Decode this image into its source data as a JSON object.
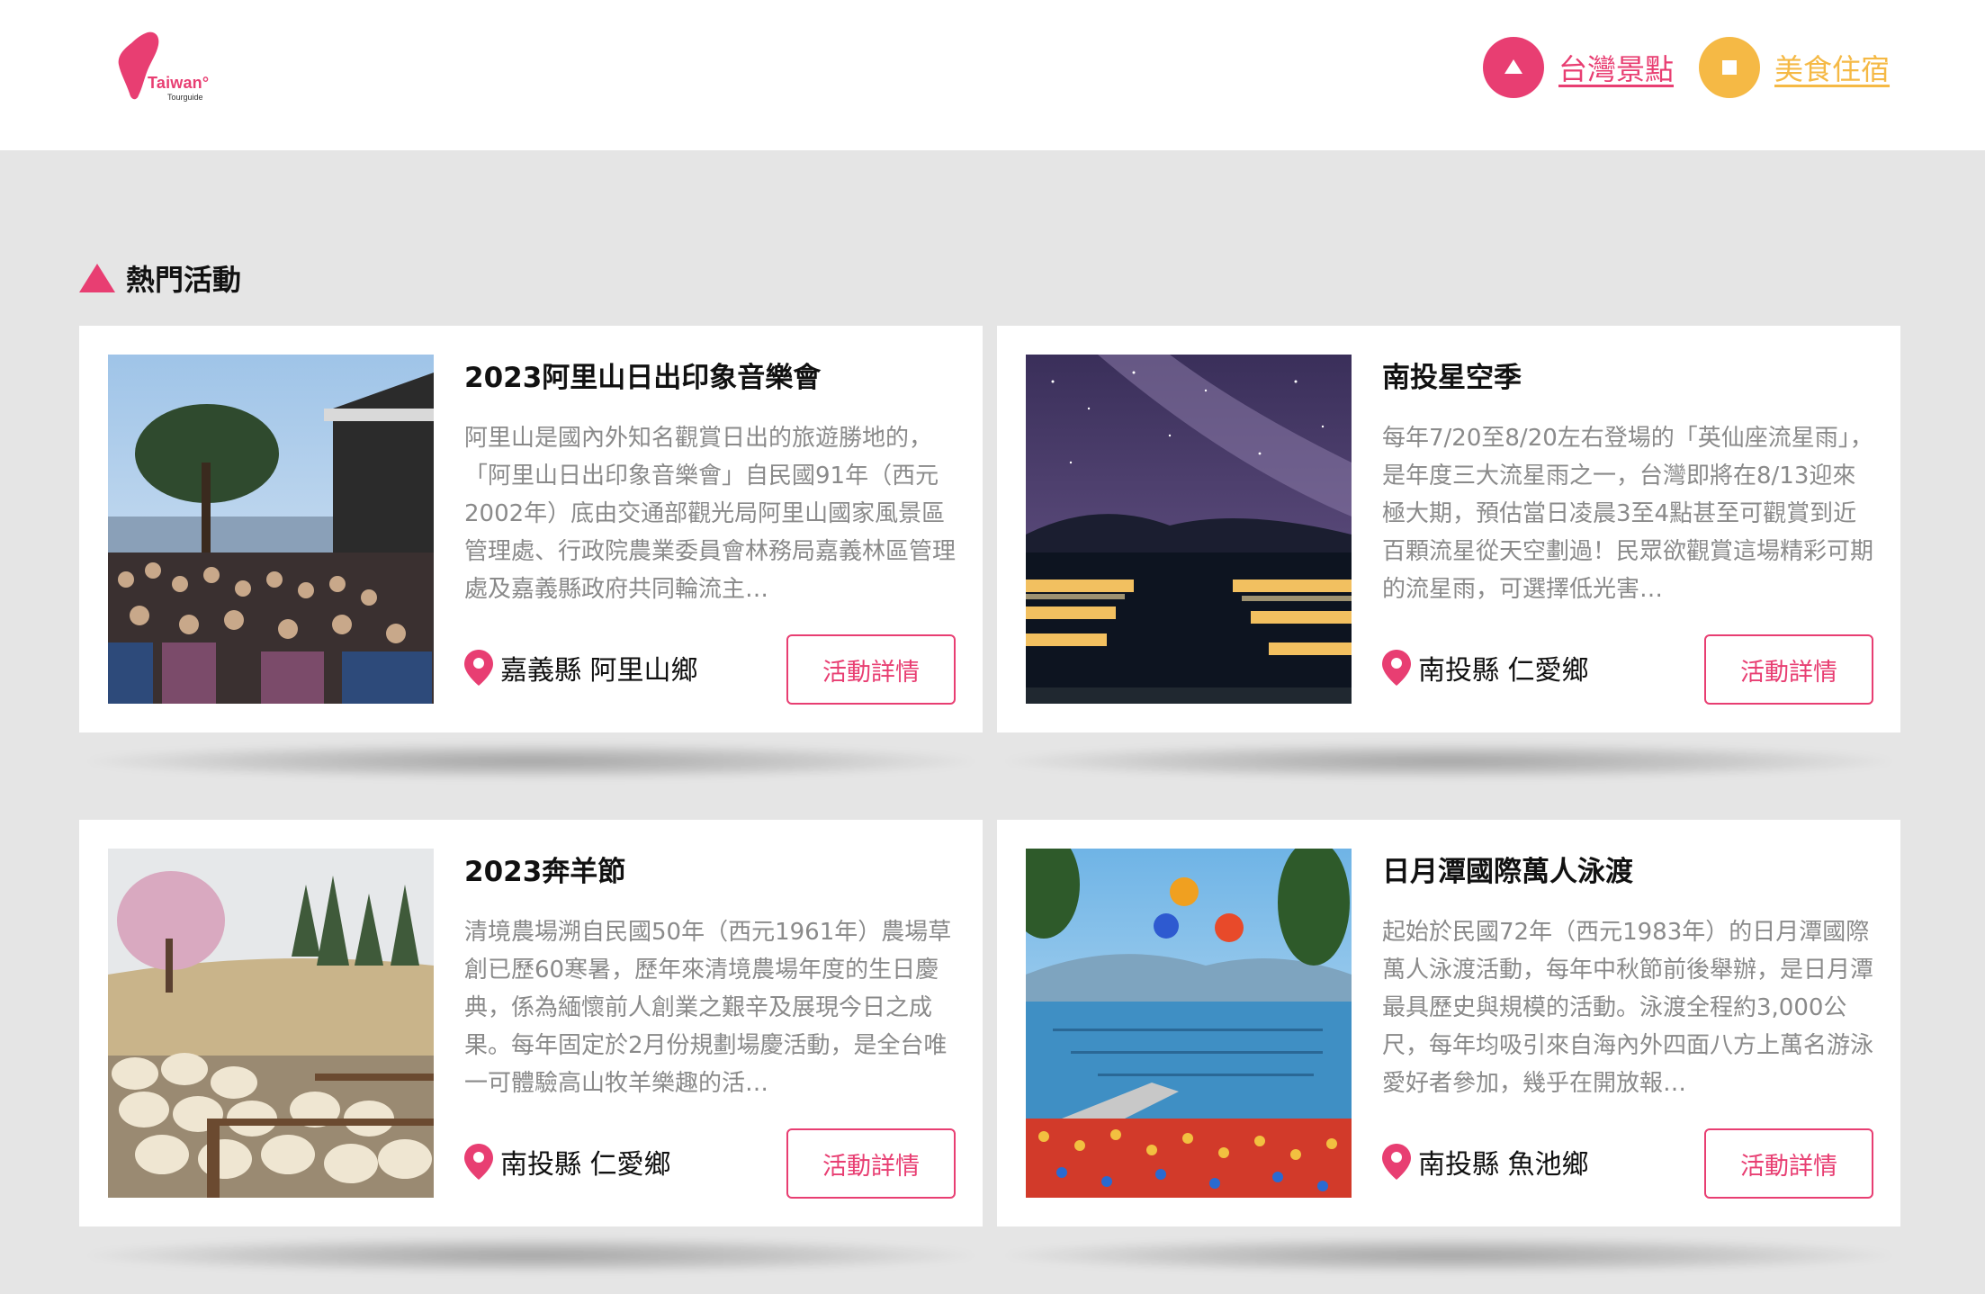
{
  "brand": {
    "logo_text": "Taiwan°",
    "logo_sub": "Tourguide"
  },
  "nav": [
    {
      "label": "台灣景點",
      "icon": "triangle-icon",
      "color": "#e83e72"
    },
    {
      "label": "美食住宿",
      "icon": "square-icon",
      "color": "#f5b945"
    }
  ],
  "section": {
    "title": "熱門活動"
  },
  "cards": [
    {
      "title": "2023阿里山日出印象音樂會",
      "description": "阿里山是國內外知名觀賞日出的旅遊勝地的，「阿里山日出印象音樂會」自民國91年（西元2002年）底由交通部觀光局阿里山國家風景區管理處、行政院農業委員會林務局嘉義林區管理處及嘉義縣政府共同輪流主…",
      "location": "嘉義縣 阿里山鄉",
      "button": "活動詳情",
      "image": "concert-crowd-photo"
    },
    {
      "title": "南投星空季",
      "description": "每年7/20至8/20左右登場的「英仙座流星雨」，是年度三大流星雨之一，台灣即將在8/13迎來極大期，預估當日凌晨3至4點甚至可觀賞到近百顆流星從天空劃過！民眾欲觀賞這場精彩可期的流星雨，可選擇低光害…",
      "location": "南投縣 仁愛鄉",
      "button": "活動詳情",
      "image": "starry-lake-photo"
    },
    {
      "title": "2023奔羊節",
      "description": "清境農場溯自民國50年（西元1961年）農場草創已歷60寒暑，歷年來清境農場年度的生日慶典，係為緬懷前人創業之艱辛及展現今日之成果。每年固定於2月份規劃場慶活動，是全台唯一可體驗高山牧羊樂趣的活…",
      "location": "南投縣 仁愛鄉",
      "button": "活動詳情",
      "image": "sheep-farm-photo"
    },
    {
      "title": "日月潭國際萬人泳渡",
      "description": "起始於民國72年（西元1983年）的日月潭國際萬人泳渡活動，每年中秋節前後舉辦，是日月潭最具歷史與規模的活動。泳渡全程約3,000公尺，每年均吸引來自海內外四面八方上萬名游泳愛好者參加，幾乎在開放報…",
      "location": "南投縣 魚池鄉",
      "button": "活動詳情",
      "image": "lake-swim-photo"
    }
  ]
}
